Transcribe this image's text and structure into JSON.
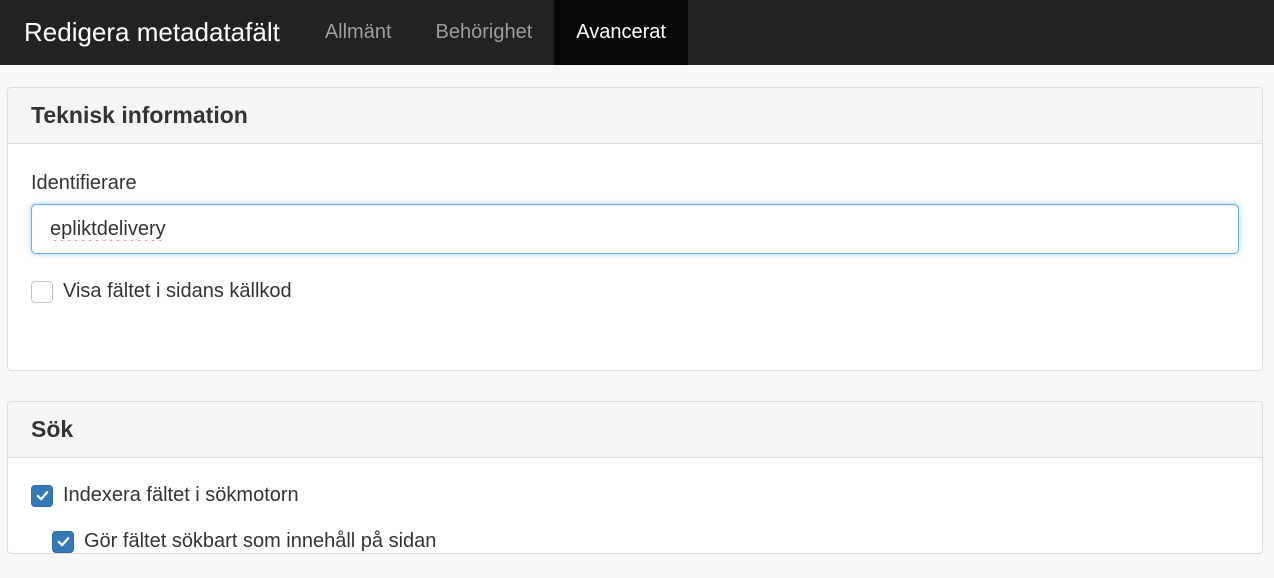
{
  "navbar": {
    "brand": "Redigera metadatafält",
    "tabs": [
      {
        "label": "Allmänt",
        "active": false
      },
      {
        "label": "Behörighet",
        "active": false
      },
      {
        "label": "Avancerat",
        "active": true
      }
    ]
  },
  "technical_panel": {
    "title": "Teknisk information",
    "identifier_label": "Identifierare",
    "identifier_value": "epliktdelivery",
    "show_in_source": {
      "label": "Visa fältet i sidans källkod",
      "checked": false
    }
  },
  "search_panel": {
    "title": "Sök",
    "index_field": {
      "label": "Indexera fältet i sökmotorn",
      "checked": true
    },
    "searchable_content": {
      "label": "Gör fältet sökbart som innehåll på sidan",
      "checked": true
    }
  },
  "colors": {
    "navbar_bg": "#222222",
    "active_tab_bg": "#080808",
    "checkbox_checked": "#337ab7",
    "input_focus_border": "#66afe9"
  },
  "icons": {
    "checkbox_checked": "check-icon"
  }
}
